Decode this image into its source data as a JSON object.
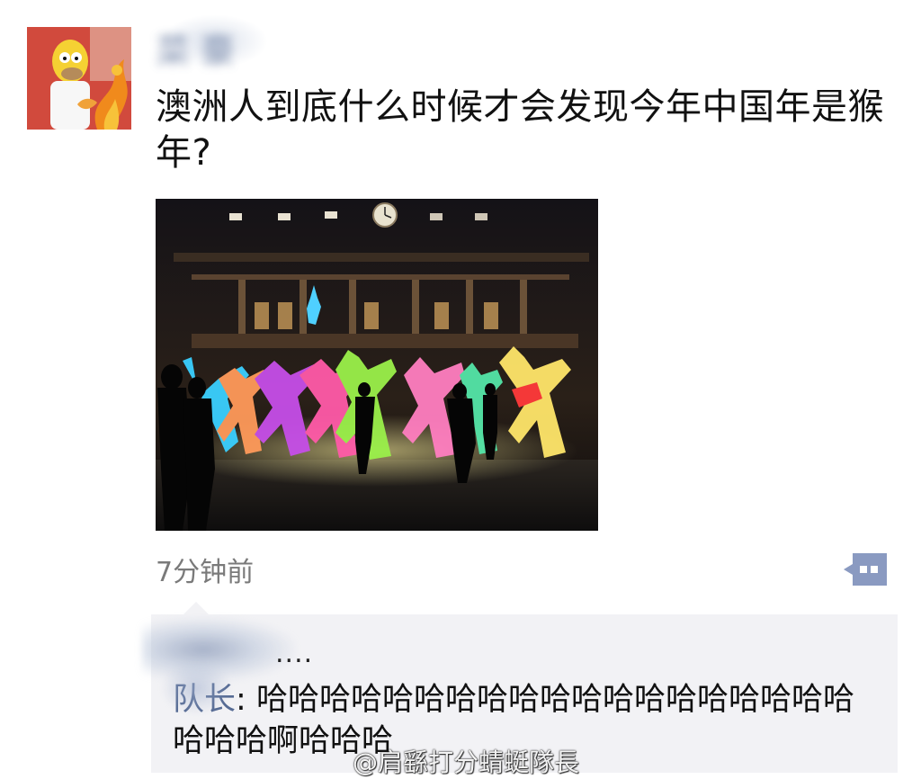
{
  "post": {
    "username": "菜   豪",
    "text": "澳洲人到底什么时候才会发现今年中国年是猴年?",
    "timestamp": "7分钟前"
  },
  "comments": {
    "likes_suffix": "....",
    "items": [
      {
        "author": "队长",
        "separator": ": ",
        "text": "哈哈哈哈哈哈哈哈哈哈哈哈哈哈哈哈哈哈哈哈哈哈啊哈哈哈"
      }
    ]
  },
  "watermark": "@肩繇打分蜻蜓隊長",
  "icons": {
    "avatar": "cartoon-avatar",
    "comment_action": "comment-bubble-icon"
  },
  "colors": {
    "name_link": "#566b94",
    "comment_bg": "#f2f2f5",
    "timestamp": "#7a7a7a",
    "action_button": "#8a9ac1"
  }
}
